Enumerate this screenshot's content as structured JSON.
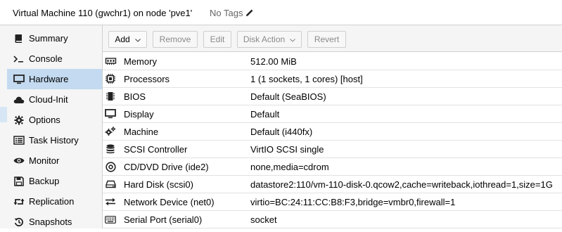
{
  "header": {
    "title": "Virtual Machine 110 (gwchr1) on node 'pve1'",
    "tags": "No Tags",
    "tags_icon": "pencil-icon"
  },
  "sidebar": {
    "items": [
      {
        "label": "Summary",
        "icon": "book-icon",
        "active": false
      },
      {
        "label": "Console",
        "icon": "terminal-icon",
        "active": false
      },
      {
        "label": "Hardware",
        "icon": "monitor-icon",
        "active": true
      },
      {
        "label": "Cloud-Init",
        "icon": "cloud-icon",
        "active": false
      },
      {
        "label": "Options",
        "icon": "gear-icon",
        "active": false
      },
      {
        "label": "Task History",
        "icon": "list-icon",
        "active": false
      },
      {
        "label": "Monitor",
        "icon": "eye-icon",
        "active": false
      },
      {
        "label": "Backup",
        "icon": "floppy-icon",
        "active": false
      },
      {
        "label": "Replication",
        "icon": "retweet-icon",
        "active": false
      },
      {
        "label": "Snapshots",
        "icon": "history-icon",
        "active": false
      }
    ]
  },
  "toolbar": {
    "add": "Add",
    "remove": "Remove",
    "edit": "Edit",
    "disk_action": "Disk Action",
    "revert": "Revert"
  },
  "hardware": {
    "rows": [
      {
        "name": "Memory",
        "value": "512.00 MiB",
        "icon": "memory-icon"
      },
      {
        "name": "Processors",
        "value": "1 (1 sockets, 1 cores) [host]",
        "icon": "cpu-icon"
      },
      {
        "name": "BIOS",
        "value": "Default (SeaBIOS)",
        "icon": "microchip-icon"
      },
      {
        "name": "Display",
        "value": "Default",
        "icon": "desktop-icon"
      },
      {
        "name": "Machine",
        "value": "Default (i440fx)",
        "icon": "cogs-icon"
      },
      {
        "name": "SCSI Controller",
        "value": "VirtIO SCSI single",
        "icon": "database-icon"
      },
      {
        "name": "CD/DVD Drive (ide2)",
        "value": "none,media=cdrom",
        "icon": "cdrom-icon"
      },
      {
        "name": "Hard Disk (scsi0)",
        "value": "datastore2:110/vm-110-disk-0.qcow2,cache=writeback,iothread=1,size=1G",
        "icon": "hdd-icon"
      },
      {
        "name": "Network Device (net0)",
        "value": "virtio=BC:24:11:CC:B8:F3,bridge=vmbr0,firewall=1",
        "icon": "exchange-icon"
      },
      {
        "name": "Serial Port (serial0)",
        "value": "socket",
        "icon": "keyboard-icon"
      }
    ]
  },
  "colors": {
    "active_nav": "#c3daf0",
    "sidebar_bg": "#f5f5f5",
    "row_border": "#e2e2e2"
  }
}
